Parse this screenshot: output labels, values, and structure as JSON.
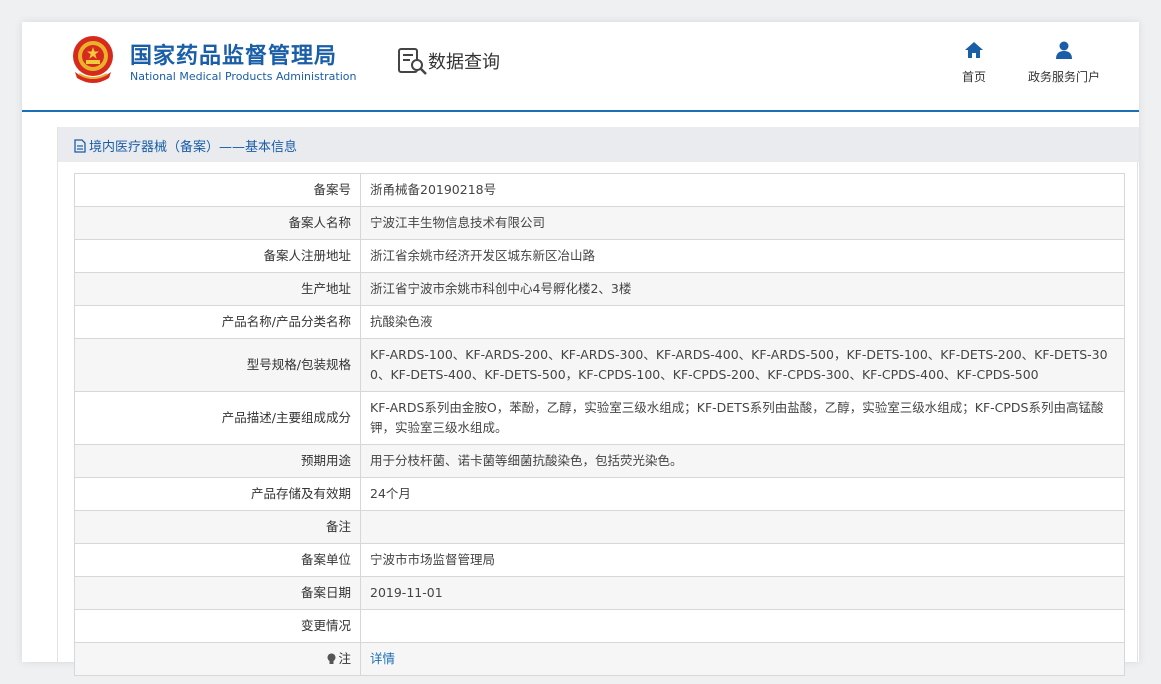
{
  "header": {
    "brand_cn": "国家药品监督管理局",
    "brand_en": "National Medical Products Administration",
    "section_label": "数据查询",
    "nav": [
      {
        "label": "首页",
        "icon": "home-icon"
      },
      {
        "label": "政务服务门户",
        "icon": "user-icon"
      }
    ]
  },
  "section": {
    "title": "境内医疗器械（备案）——基本信息",
    "icon": "document-icon"
  },
  "rows": [
    {
      "label": "备案号",
      "value": "浙甬械备20190218号"
    },
    {
      "label": "备案人名称",
      "value": "宁波江丰生物信息技术有限公司"
    },
    {
      "label": "备案人注册地址",
      "value": "浙江省余姚市经济开发区城东新区冶山路"
    },
    {
      "label": "生产地址",
      "value": "浙江省宁波市余姚市科创中心4号孵化楼2、3楼"
    },
    {
      "label": "产品名称/产品分类名称",
      "value": "抗酸染色液"
    },
    {
      "label": "型号规格/包装规格",
      "value": "KF-ARDS-100、KF-ARDS-200、KF-ARDS-300、KF-ARDS-400、KF-ARDS-500，KF-DETS-100、KF-DETS-200、KF-DETS-300、KF-DETS-400、KF-DETS-500，KF-CPDS-100、KF-CPDS-200、KF-CPDS-300、KF-CPDS-400、KF-CPDS-500"
    },
    {
      "label": "产品描述/主要组成成分",
      "value": "KF-ARDS系列由金胺O，苯酚，乙醇，实验室三级水组成；KF-DETS系列由盐酸，乙醇，实验室三级水组成；KF-CPDS系列由高锰酸钾，实验室三级水组成。"
    },
    {
      "label": "预期用途",
      "value": "用于分枝杆菌、诺卡菌等细菌抗酸染色，包括荧光染色。"
    },
    {
      "label": "产品存储及有效期",
      "value": "24个月"
    },
    {
      "label": "备注",
      "value": ""
    },
    {
      "label": "备案单位",
      "value": "宁波市市场监督管理局"
    },
    {
      "label": "备案日期",
      "value": "2019-11-01"
    },
    {
      "label": "变更情况",
      "value": ""
    },
    {
      "label": "注",
      "value": "详情",
      "icon": "lightbulb-icon"
    }
  ],
  "colors": {
    "brand_blue": "#1a5ea8",
    "link_blue": "#1a6fb5",
    "section_bg": "#e9ebee"
  }
}
